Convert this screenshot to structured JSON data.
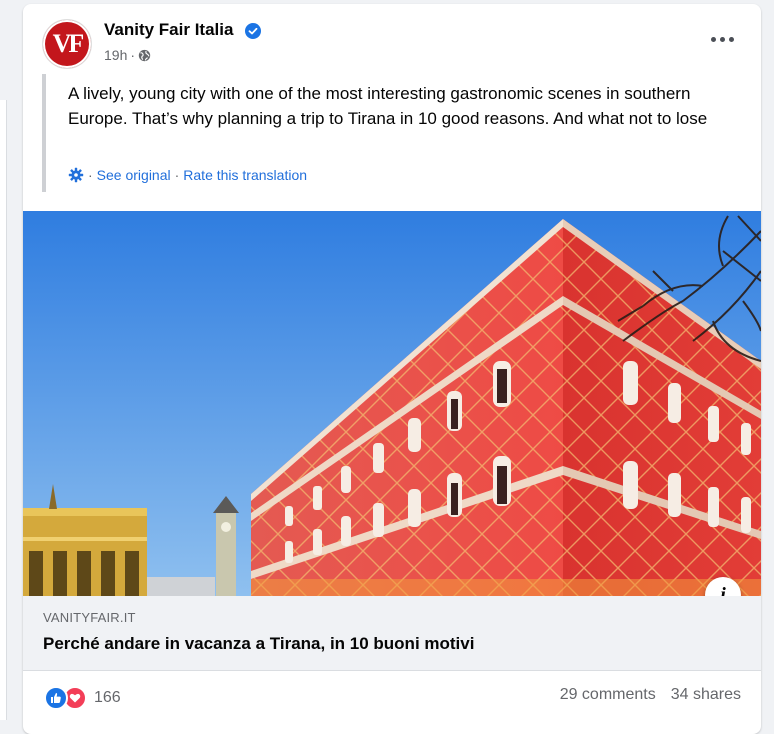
{
  "post": {
    "page_name": "Vanity Fair Italia",
    "logo_text": "VF",
    "time": "19h",
    "separator": "·",
    "text": "A lively, young city with one of the most interesting gastronomic scenes in southern Europe. That’s why planning a trip to Tirana in 10 good reasons. And what not to lose",
    "translation": {
      "see_original": "See original",
      "rate": "Rate this translation",
      "separator": "·"
    }
  },
  "link_preview": {
    "domain": "VANITYFAIR.IT",
    "title": "Perché andare in vacanza a Tirana, in 10 buoni motivi",
    "info_icon": "i"
  },
  "engagement": {
    "reaction_count": "166",
    "comments": "29 comments",
    "shares": "34 shares"
  },
  "colors": {
    "accent": "#1b74e4",
    "love": "#f33e58",
    "link_blue": "#216fdb",
    "building_red": "#e8463f"
  }
}
